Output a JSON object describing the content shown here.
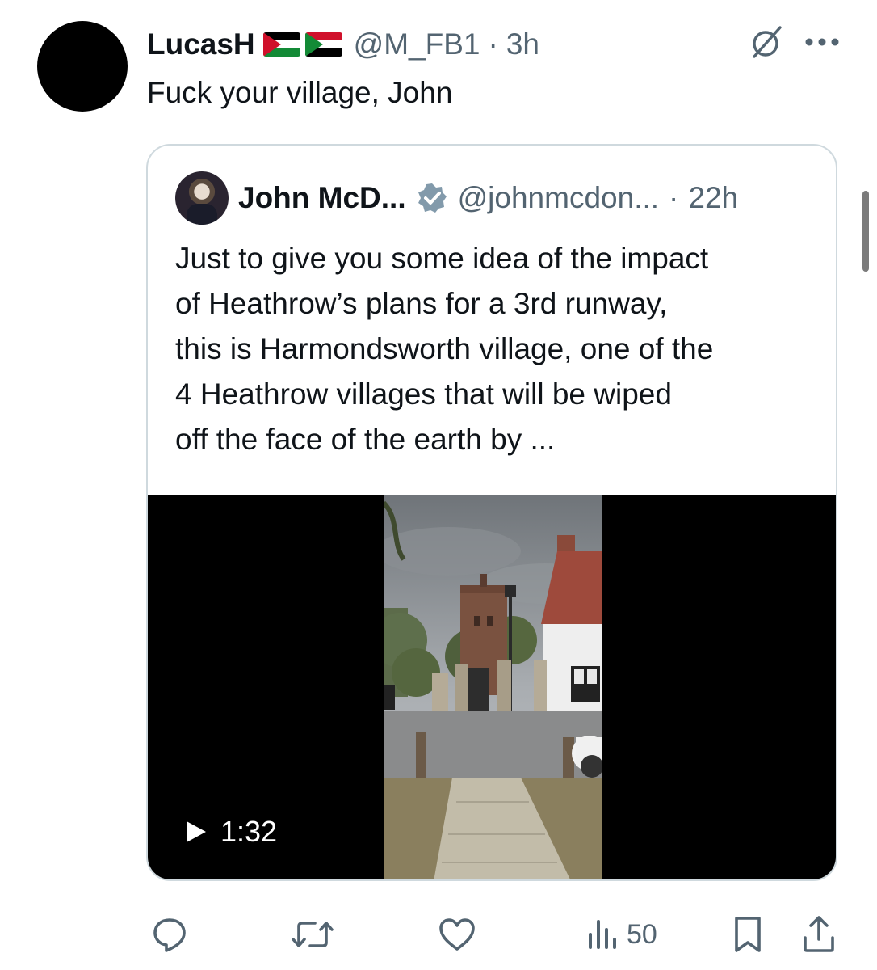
{
  "tweet": {
    "author": {
      "display_name": "LucasH",
      "flags": [
        "palestine-flag",
        "sudan-flag"
      ],
      "handle": "@M_FB1",
      "time_separator": "·",
      "time": "3h"
    },
    "text": "Fuck your village, John",
    "icons": {
      "grok": "grok-icon",
      "more": "more-icon"
    }
  },
  "quoted_tweet": {
    "author": {
      "display_name": "John McD...",
      "verified": true,
      "handle": "@johnmcdon...",
      "time_separator": "·",
      "time": "22h"
    },
    "text_lines": [
      "Just to give you some idea of the impact",
      "of Heathrow’s plans for a 3rd runway,",
      "this is Harmondsworth village, one of the",
      "4 Heathrow villages that will be wiped",
      "off the face of the earth by ..."
    ],
    "media": {
      "type": "video",
      "duration": "1:32"
    }
  },
  "actions": {
    "reply_icon": "reply-icon",
    "retweet_icon": "retweet-icon",
    "like_icon": "heart-icon",
    "views_icon": "views-icon",
    "views_count": "50",
    "bookmark_icon": "bookmark-icon",
    "share_icon": "share-icon"
  },
  "colors": {
    "text": "#0f1419",
    "secondary": "#536471",
    "border": "#cfd9de",
    "verified": "#829aab"
  }
}
